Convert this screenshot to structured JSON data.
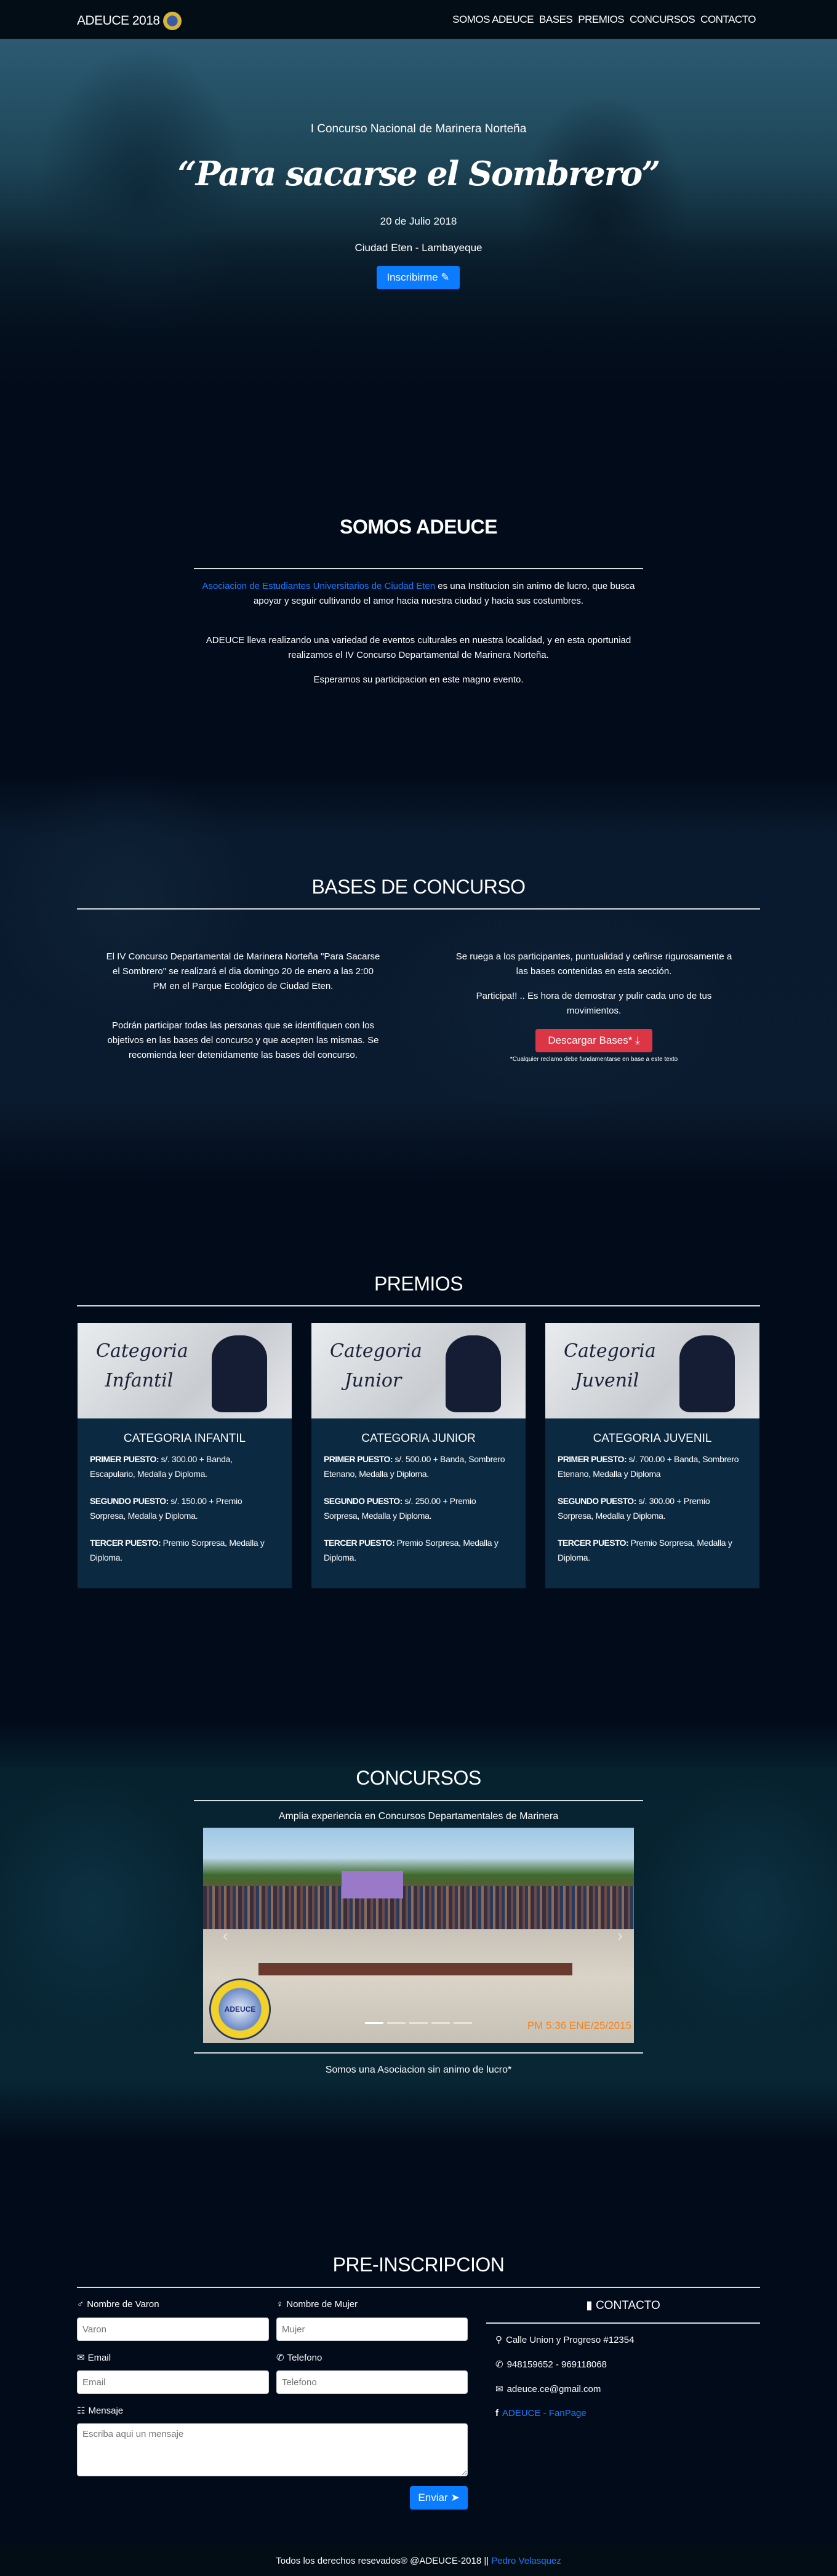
{
  "nav": {
    "brand": "ADEUCE 2018",
    "links": [
      "SOMOS ADEUCE",
      "BASES",
      "PREMIOS",
      "CONCURSOS",
      "CONTACTO"
    ]
  },
  "hero": {
    "subtitle": "I Concurso Nacional de Marinera Norteña",
    "title": "“Para sacarse el Sombrero”",
    "date": "20 de Julio 2018",
    "location": "Ciudad Eten - Lambayeque",
    "button": "Inscribirme"
  },
  "somos": {
    "title": "SOMOS ADEUCE",
    "link": "Asociacion de Estudiantes Universitarios de Ciudad Eten",
    "p1_rest": " es una Institucion sin animo de lucro, que busca apoyar y seguir cultivando el amor hacia nuestra ciudad y hacia sus costumbres.",
    "p2": "ADEUCE lleva realizando una variedad de eventos culturales en nuestra localidad, y en esta oportuniad realizamos el IV Concurso Departamental de Marinera Norteña.",
    "p3": "Esperamos su participacion en este magno evento."
  },
  "bases": {
    "title": "BASES DE CONCURSO",
    "left_p1": "El IV Concurso Departamental de Marinera Norteña \"Para Sacarse el Sombrero\" se realizará el dia domingo 20 de enero a las 2:00 PM en el Parque Ecológico de Ciudad Eten.",
    "left_p2": "Podrán participar todas las personas que se identifiquen con los objetivos en las bases del concurso y que acepten las mismas. Se recomienda leer detenidamente las bases del concurso.",
    "right_p1": "Se ruega a los participantes, puntualidad y ceñirse rigurosamente a las bases contenidas en esta sección.",
    "right_p2": "Participa!! .. Es hora de demostrar y pulir cada uno de tus movimientos.",
    "button": "Descargar Bases*",
    "note": "*Cualquier reclamo debe fundamentarse en base a este texto"
  },
  "premios": {
    "title": "PREMIOS",
    "cards": [
      {
        "img_line1": "Categoria",
        "img_line2": "Infantil",
        "title": "CATEGORIA INFANTIL",
        "p1_label": "PRIMER PUESTO:",
        "p1": " s/. 300.00 + Banda, Escapulario, Medalla y Diploma.",
        "p2_label": "SEGUNDO PUESTO:",
        "p2": " s/. 150.00 + Premio Sorpresa, Medalla y Diploma.",
        "p3_label": "TERCER PUESTO:",
        "p3": " Premio Sorpresa, Medalla y Diploma."
      },
      {
        "img_line1": "Categoria",
        "img_line2": "Junior",
        "title": "CATEGORIA JUNIOR",
        "p1_label": "PRIMER PUESTO:",
        "p1": " s/. 500.00 + Banda, Sombrero Etenano, Medalla y Diploma.",
        "p2_label": "SEGUNDO PUESTO:",
        "p2": " s/. 250.00 + Premio Sorpresa, Medalla y Diploma.",
        "p3_label": "TERCER PUESTO:",
        "p3": " Premio Sorpresa, Medalla y Diploma."
      },
      {
        "img_line1": "Categoria",
        "img_line2": "Juvenil",
        "title": "CATEGORIA JUVENIL",
        "p1_label": "PRIMER PUESTO:",
        "p1": " s/. 700.00 + Banda, Sombrero Etenano, Medalla y Diploma",
        "p2_label": "SEGUNDO PUESTO:",
        "p2": " s/. 300.00 + Premio Sorpresa, Medalla y Diploma.",
        "p3_label": "TERCER PUESTO:",
        "p3": " Premio Sorpresa, Medalla y Diploma."
      }
    ]
  },
  "concursos": {
    "title": "CONCURSOS",
    "subtitle": "Amplia experiencia en Concursos Departamentales de Marinera",
    "photo_stamp": "PM 5:36 ENE/25/2015",
    "logo_text": "ADEUCE",
    "carousel_active": 1,
    "carousel_count": 5,
    "footer_note": "Somos una Asociacion sin animo de lucro*"
  },
  "form": {
    "title": "PRE-INSCRIPCION",
    "varon_label": "Nombre de Varon",
    "varon_ph": "Varon",
    "mujer_label": "Nombre de Mujer",
    "mujer_ph": "Mujer",
    "email_label": "Email",
    "email_ph": "Email",
    "tel_label": "Telefono",
    "tel_ph": "Telefono",
    "msg_label": "Mensaje",
    "msg_ph": "Escriba aqui un mensaje",
    "submit": "Enviar"
  },
  "contacto": {
    "title": "CONTACTO",
    "address": "Calle Union y Progreso #12354",
    "phone": "948159652 - 969118068",
    "email": "adeuce.ce@gmail.com",
    "fanpage": "ADEUCE - FanPage"
  },
  "footer": {
    "text": "Todos los derechos resevados® @ADEUCE-2018 || ",
    "author": "Pedro Velasquez"
  },
  "colors": {
    "accent": "#0b7bff",
    "danger": "#dc3545",
    "bg": "#020b1a",
    "card": "#0b2940"
  }
}
